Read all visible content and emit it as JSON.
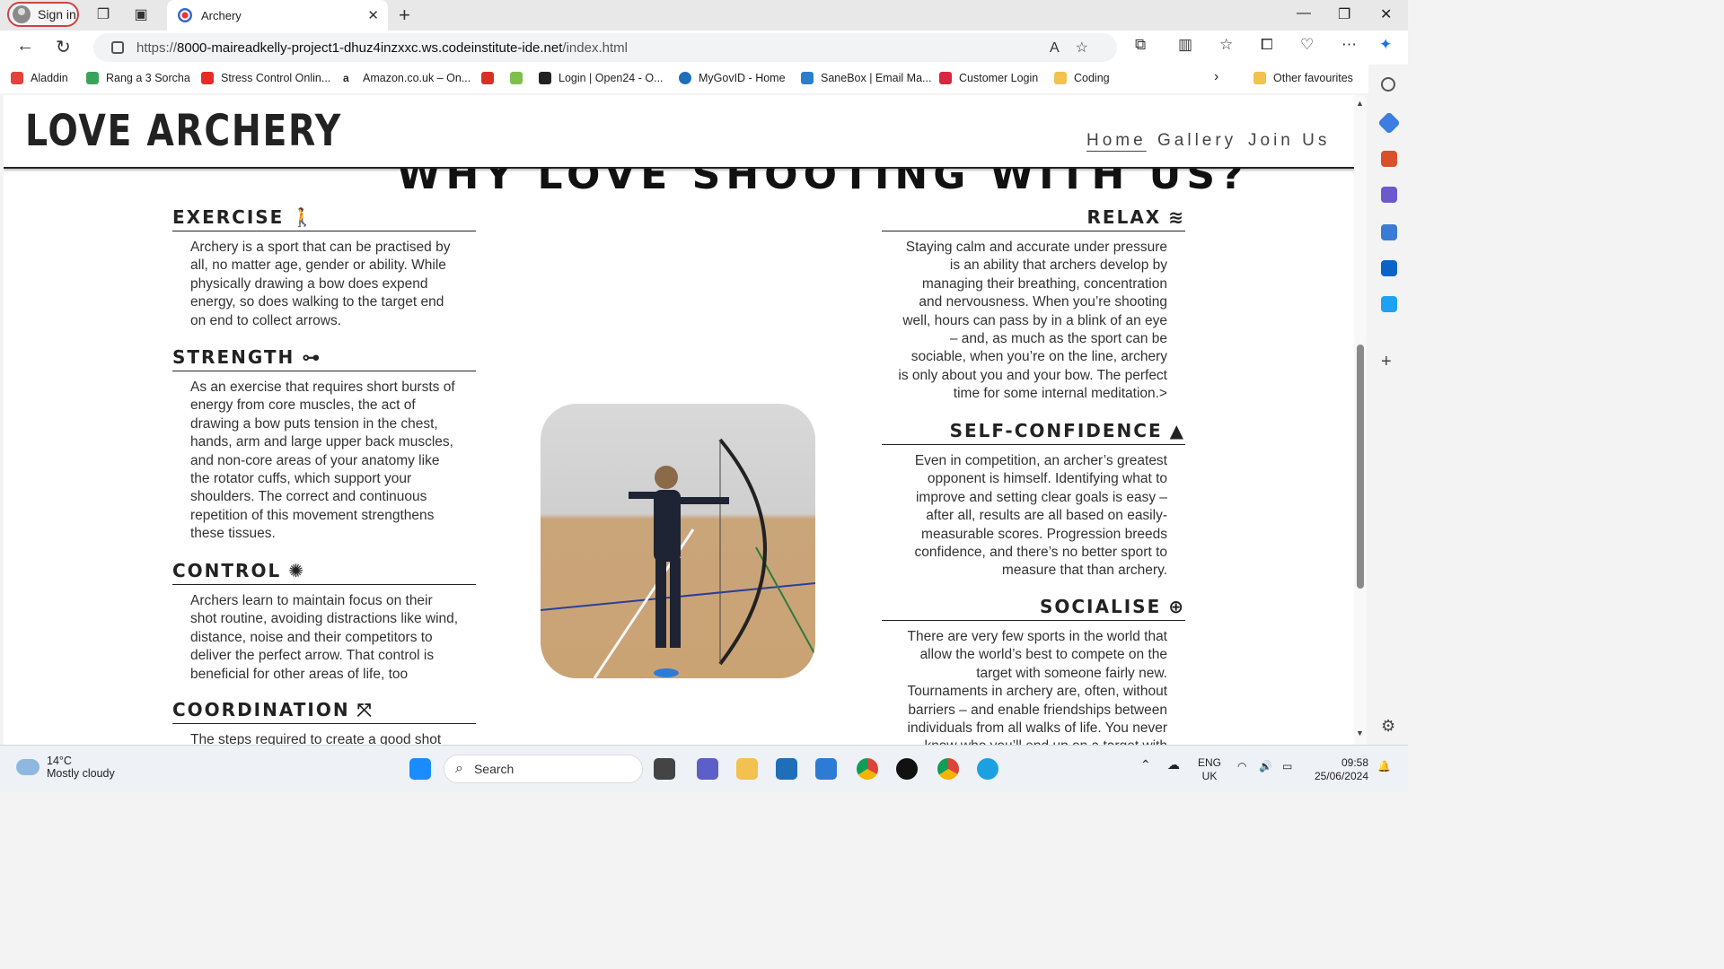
{
  "browser": {
    "signin_label": "Sign in",
    "tab_title": "Archery",
    "url_prefix": "https://",
    "url_host": "8000-maireadkelly-project1-dhuz4inzxxc.ws.codeinstitute-ide.net",
    "url_path": "/index.html",
    "bookmarks": [
      {
        "label": "Aladdin",
        "color": "#e2443b"
      },
      {
        "label": "Rang a 3 Sorcha",
        "color": "#3aa35b"
      },
      {
        "label": "Stress Control Onlin...",
        "color": "#e52d27"
      },
      {
        "label": "Amazon.co.uk – On...",
        "color": "#222222"
      },
      {
        "label": "",
        "color": "#d93025"
      },
      {
        "label": "",
        "color": "#7fbf4d"
      },
      {
        "label": "Login | Open24 - O...",
        "color": "#222222"
      },
      {
        "label": "MyGovID - Home",
        "color": "#1e6fb8"
      },
      {
        "label": "SaneBox | Email Ma...",
        "color": "#2d7ec8"
      },
      {
        "label": "Customer Login",
        "color": "#d7263d"
      },
      {
        "label": "Coding",
        "color": "#f2c14e"
      }
    ],
    "other_favourites": "Other favourites"
  },
  "site": {
    "logo": "LOVE ARCHERY",
    "nav": [
      "Home",
      "Gallery",
      "Join Us"
    ],
    "section_title": "WHY LOVE SHOOTING WITH US?"
  },
  "features_left": [
    {
      "title": "EXERCISE",
      "icon": "walking-icon",
      "text": "Archery is a sport that can be practised by all, no matter age, gender or ability. While physically drawing a bow does expend energy, so does walking to the target end on end to collect arrows."
    },
    {
      "title": "STRENGTH",
      "icon": "dumbbell-icon",
      "text": "As an exercise that requires short bursts of energy from core muscles, the act of drawing a bow puts tension in the chest, hands, arm and large upper back muscles, and non-core areas of your anatomy like the rotator cuffs, which support your shoulders. The correct and continuous repetition of this movement strengthens these tissues."
    },
    {
      "title": "CONTROL",
      "icon": "virus-icon",
      "text": "Archers learn to maintain focus on their shot routine, avoiding distractions like wind, distance, noise and their competitors to deliver the perfect arrow. That control is beneficial for other areas of life, too"
    },
    {
      "title": "COORDINATION",
      "icon": "arrows-to-dot-icon",
      "text": "The steps required to create a good shot"
    }
  ],
  "features_right": [
    {
      "title": "RELAX",
      "icon": "water-icon",
      "text": "Staying calm and accurate under pressure is an ability that archers develop by managing their breathing, concentration and nervousness. When you’re shooting well, hours can pass by in a blink of an eye – and, as much as the sport can be sociable, when you’re on the line, archery is only about you and your bow. The perfect time for some internal meditation.>"
    },
    {
      "title": "SELF-CONFIDENCE",
      "icon": "tree-icon",
      "text": "Even in competition, an archer’s greatest opponent is himself. Identifying what to improve and setting clear goals is easy – after all, results are all based on easily-measurable scores. Progression breeds confidence, and there’s no better sport to measure that than archery."
    },
    {
      "title": "SOCIALISE",
      "icon": "globe-icon",
      "text": "There are very few sports in the world that allow the world’s best to compete on the target with someone fairly new. Tournaments in archery are, often, without barriers – and enable friendships between individuals from all walks of life. You never know who you’ll end up on a target with"
    }
  ],
  "taskbar": {
    "temp": "14°C",
    "weather": "Mostly cloudy",
    "search": "Search",
    "lang1": "ENG",
    "lang2": "UK",
    "time": "09:58",
    "date": "25/06/2024"
  }
}
